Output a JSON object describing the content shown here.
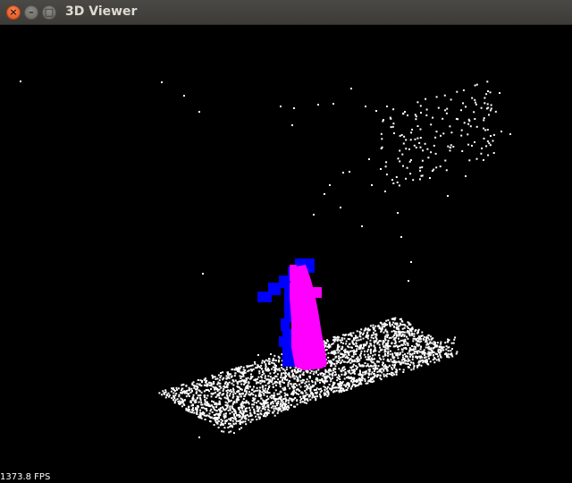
{
  "window": {
    "title": "3D Viewer",
    "buttons": {
      "close_glyph": "×",
      "minimize_glyph": "–",
      "maximize_glyph": "□"
    }
  },
  "viewport": {
    "background": "#000000",
    "point_color": "#ffffff",
    "person_colors": {
      "body": "#ff00ff",
      "arms": "#0000ff"
    }
  },
  "status": {
    "fps": "1373.8 FPS"
  }
}
